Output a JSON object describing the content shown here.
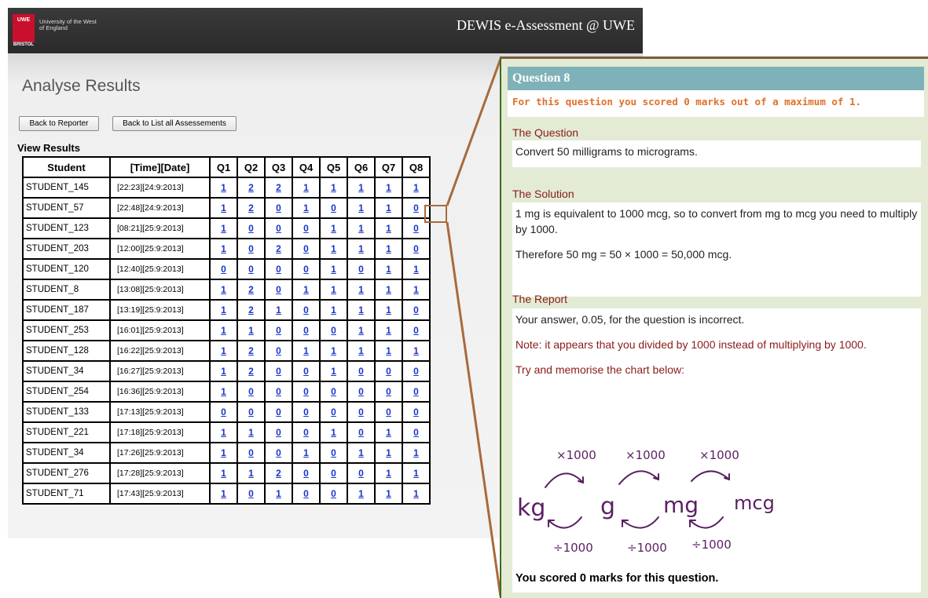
{
  "header": {
    "logo_text": "UWE",
    "logo_city": "BRISTOL",
    "university_name": "University of the West of England",
    "app_title": "DEWIS e-Assessment @ UWE"
  },
  "page": {
    "title": "Analyse Results",
    "back_reporter": "Back to Reporter",
    "back_list": "Back to List all Assessements",
    "view_results": "View Results"
  },
  "table": {
    "headers": [
      "Student",
      "[Time][Date]",
      "Q1",
      "Q2",
      "Q3",
      "Q4",
      "Q5",
      "Q6",
      "Q7",
      "Q8"
    ],
    "rows": [
      {
        "student": "STUDENT_145",
        "time": "[22:23][24:9:2013]",
        "scores": [
          "1",
          "2",
          "2",
          "1",
          "1",
          "1",
          "1",
          "1"
        ]
      },
      {
        "student": "STUDENT_57",
        "time": "[22:48][24:9:2013]",
        "scores": [
          "1",
          "2",
          "0",
          "1",
          "0",
          "1",
          "1",
          "0"
        ]
      },
      {
        "student": "STUDENT_123",
        "time": "[08:21][25:9:2013]",
        "scores": [
          "1",
          "0",
          "0",
          "0",
          "1",
          "1",
          "1",
          "0"
        ]
      },
      {
        "student": "STUDENT_203",
        "time": "[12:00][25:9:2013]",
        "scores": [
          "1",
          "0",
          "2",
          "0",
          "1",
          "1",
          "1",
          "0"
        ]
      },
      {
        "student": "STUDENT_120",
        "time": "[12:40][25:9:2013]",
        "scores": [
          "0",
          "0",
          "0",
          "0",
          "1",
          "0",
          "1",
          "1"
        ]
      },
      {
        "student": "STUDENT_8",
        "time": "[13:08][25:9:2013]",
        "scores": [
          "1",
          "2",
          "0",
          "1",
          "1",
          "1",
          "1",
          "1"
        ]
      },
      {
        "student": "STUDENT_187",
        "time": "[13:19][25:9:2013]",
        "scores": [
          "1",
          "2",
          "1",
          "0",
          "1",
          "1",
          "1",
          "0"
        ]
      },
      {
        "student": "STUDENT_253",
        "time": "[16:01][25:9:2013]",
        "scores": [
          "1",
          "1",
          "0",
          "0",
          "0",
          "1",
          "1",
          "0"
        ]
      },
      {
        "student": "STUDENT_128",
        "time": "[16:22][25:9:2013]",
        "scores": [
          "1",
          "2",
          "0",
          "1",
          "1",
          "1",
          "1",
          "1"
        ]
      },
      {
        "student": "STUDENT_34",
        "time": "[16:27][25:9:2013]",
        "scores": [
          "1",
          "2",
          "0",
          "0",
          "1",
          "0",
          "0",
          "0"
        ]
      },
      {
        "student": "STUDENT_254",
        "time": "[16:36][25:9:2013]",
        "scores": [
          "1",
          "0",
          "0",
          "0",
          "0",
          "0",
          "0",
          "0"
        ]
      },
      {
        "student": "STUDENT_133",
        "time": "[17:13][25:9:2013]",
        "scores": [
          "0",
          "0",
          "0",
          "0",
          "0",
          "0",
          "0",
          "0"
        ]
      },
      {
        "student": "STUDENT_221",
        "time": "[17:18][25:9:2013]",
        "scores": [
          "1",
          "1",
          "0",
          "0",
          "1",
          "0",
          "1",
          "0"
        ]
      },
      {
        "student": "STUDENT_34",
        "time": "[17:26][25:9:2013]",
        "scores": [
          "1",
          "0",
          "0",
          "1",
          "0",
          "1",
          "1",
          "1"
        ]
      },
      {
        "student": "STUDENT_276",
        "time": "[17:28][25:9:2013]",
        "scores": [
          "1",
          "1",
          "2",
          "0",
          "0",
          "0",
          "1",
          "1"
        ]
      },
      {
        "student": "STUDENT_71",
        "time": "[17:43][25:9:2013]",
        "scores": [
          "1",
          "0",
          "1",
          "0",
          "0",
          "1",
          "1",
          "1"
        ]
      }
    ]
  },
  "question": {
    "title": "Question 8",
    "score_line": "For this question you scored 0 marks out of a maximum of 1.",
    "question_heading": "The Question",
    "question_text": "Convert 50 milligrams to micrograms.",
    "solution_heading": "The Solution",
    "solution_text_1": "1 mg is equivalent to 1000 mcg, so to convert from mg to mcg you need to multiply by 1000.",
    "solution_text_2": "Therefore 50 mg = 50 × 1000 = 50,000 mcg.",
    "report_heading": "The Report",
    "report_text_1": "Your answer, 0.05, for the question is incorrect.",
    "report_note": "Note: it appears that you divided by 1000 instead of multiplying by 1000.",
    "report_try": "Try and memorise the chart below:",
    "final_score": "You scored 0 marks for this question."
  },
  "conversion_chart": {
    "units": [
      "kg",
      "g",
      "mg",
      "mcg"
    ],
    "multiply_label": "×1000",
    "divide_label": "÷1000"
  },
  "colors": {
    "header_bg": "#2e2e2e",
    "link": "#1a35c8",
    "question_header": "#7fb2b8",
    "score_orange": "#e0702a",
    "section_heading": "#8b1a1a",
    "panel_bg": "#e3ebd5",
    "chart_ink": "#5b1f63",
    "callout": "#a86a3c"
  }
}
